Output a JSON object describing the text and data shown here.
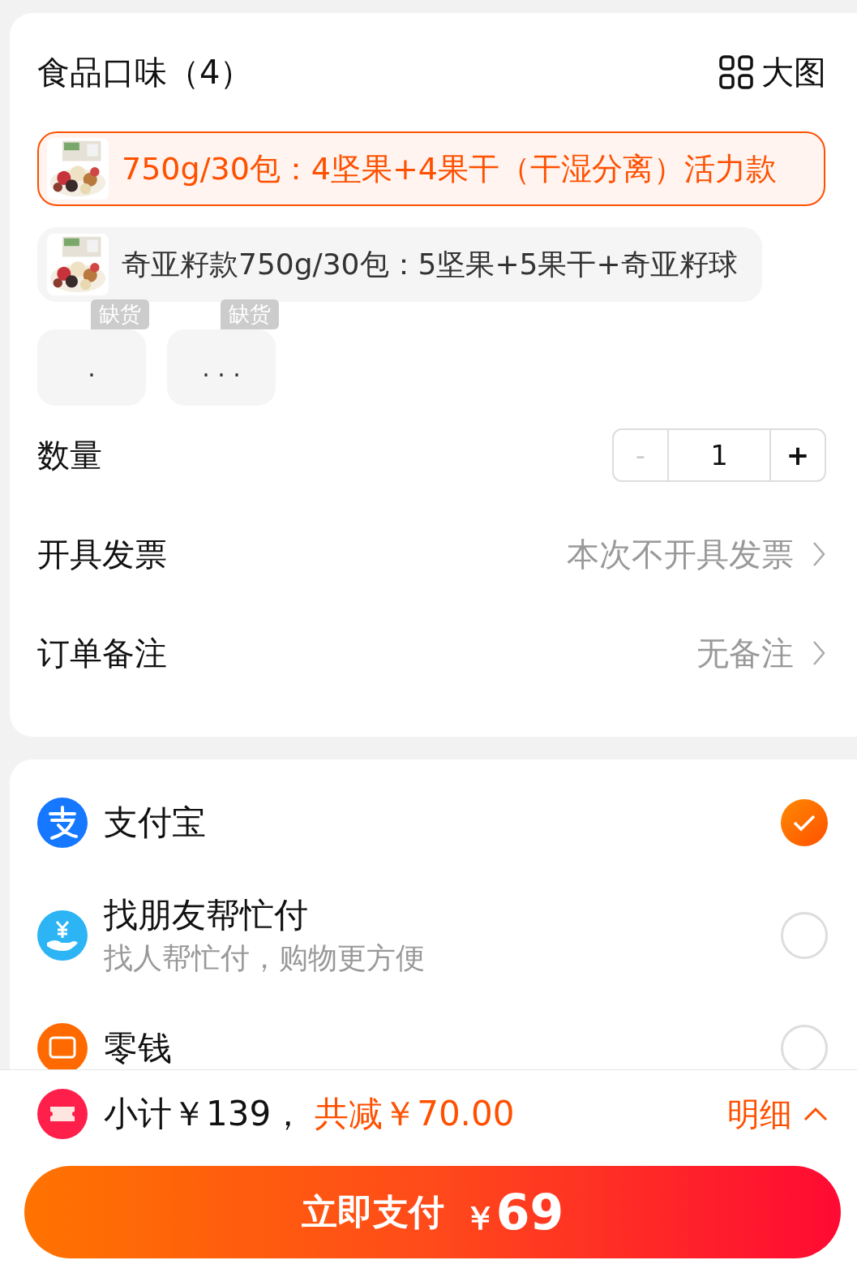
{
  "header": {
    "title": "食品口味（4）",
    "view_toggle": "大图"
  },
  "flavors": [
    {
      "label": "750g/30包：4坚果+4果干（干湿分离）活力款",
      "selected": true
    },
    {
      "label": "奇亚籽款750g/30包：5坚果+5果干+奇亚籽球",
      "selected": false
    },
    {
      "kind": "text",
      "label": ".",
      "badge": "缺货",
      "selected": false
    },
    {
      "kind": "text",
      "label": ". . .",
      "badge": "缺货",
      "selected": false
    }
  ],
  "quantity": {
    "label": "数量",
    "minus": "-",
    "value": "1",
    "plus": "+",
    "minus_disabled": true
  },
  "rows": [
    {
      "label": "开具发票",
      "value": "本次不开具发票"
    },
    {
      "label": "订单备注",
      "value": "无备注"
    }
  ],
  "payments": [
    {
      "kind": "alipay",
      "name": "支付宝",
      "selected": true
    },
    {
      "kind": "friend",
      "name": "找朋友帮忙付",
      "hint": "找人帮忙付，购物更方便",
      "selected": false
    },
    {
      "kind": "change",
      "name": "零钱",
      "selected": false
    }
  ],
  "footer": {
    "subtotal": "小计￥139，",
    "discount": "共减￥70.00",
    "detail": "明细",
    "pay_label": "立即支付",
    "pay_currency": "￥",
    "pay_amount": "69"
  }
}
